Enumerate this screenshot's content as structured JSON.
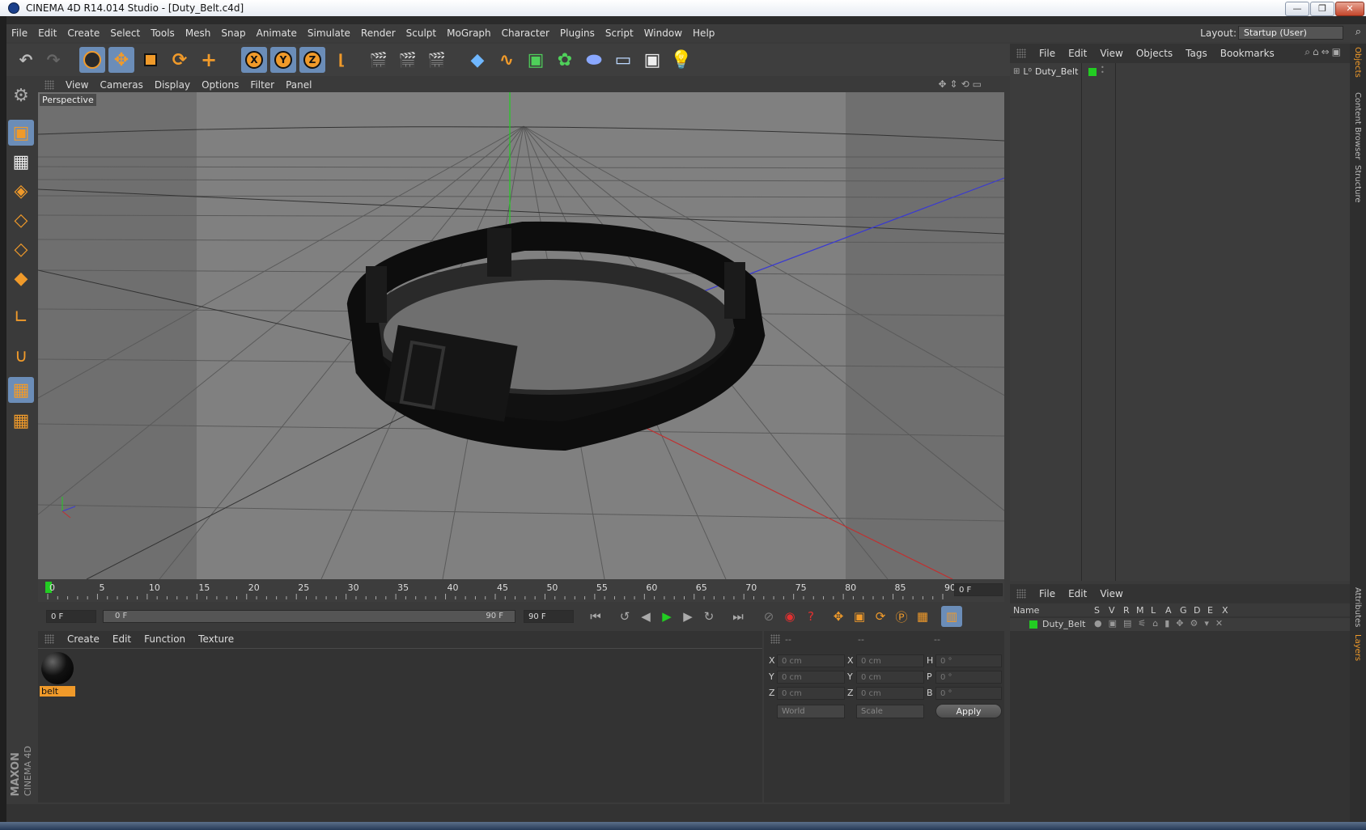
{
  "window": {
    "title": "CINEMA 4D R14.014 Studio - [Duty_Belt.c4d]",
    "min_label": "—",
    "max_label": "❐",
    "close_label": "✕"
  },
  "menubar": {
    "items": [
      "File",
      "Edit",
      "Create",
      "Select",
      "Tools",
      "Mesh",
      "Snap",
      "Animate",
      "Simulate",
      "Render",
      "Sculpt",
      "MoGraph",
      "Character",
      "Plugins",
      "Script",
      "Window",
      "Help"
    ],
    "layout_label": "Layout:",
    "layout_value": "Startup (User)"
  },
  "toolbar": {
    "axis_x": "X",
    "axis_y": "Y",
    "axis_z": "Z"
  },
  "viewport": {
    "menu": [
      "View",
      "Cameras",
      "Display",
      "Options",
      "Filter",
      "Panel"
    ],
    "label": "Perspective"
  },
  "timeline": {
    "ticks": [
      "0",
      "5",
      "10",
      "15",
      "20",
      "25",
      "30",
      "35",
      "40",
      "45",
      "50",
      "55",
      "60",
      "65",
      "70",
      "75",
      "80",
      "85",
      "90"
    ],
    "current_frame": "0 F",
    "start_frame": "0 F",
    "range_start": "0 F",
    "range_end": "90 F",
    "end_frame": "90 F"
  },
  "material_manager": {
    "menu": [
      "Create",
      "Edit",
      "Function",
      "Texture"
    ],
    "materials": [
      {
        "name": "belt"
      }
    ]
  },
  "coordinates": {
    "headers": [
      "--",
      "--",
      "--"
    ],
    "rows": [
      {
        "a": "X",
        "av": "0 cm",
        "b": "X",
        "bv": "0 cm",
        "c": "H",
        "cv": "0 °"
      },
      {
        "a": "Y",
        "av": "0 cm",
        "b": "Y",
        "bv": "0 cm",
        "c": "P",
        "cv": "0 °"
      },
      {
        "a": "Z",
        "av": "0 cm",
        "b": "Z",
        "bv": "0 cm",
        "c": "B",
        "cv": "0 °"
      }
    ],
    "mode": "World",
    "size_mode": "Scale",
    "apply": "Apply"
  },
  "object_manager": {
    "menu": [
      "File",
      "Edit",
      "View",
      "Objects",
      "Tags",
      "Bookmarks"
    ],
    "objects": [
      {
        "name": "Duty_Belt"
      }
    ]
  },
  "layer_manager": {
    "menu": [
      "File",
      "Edit",
      "View"
    ],
    "columns": [
      "Name",
      "S",
      "V",
      "R",
      "M",
      "L",
      "A",
      "G",
      "D",
      "E",
      "X"
    ],
    "rows": [
      {
        "name": "Duty_Belt"
      }
    ]
  },
  "side_tabs": [
    "Objects",
    "Content Browser",
    "Structure"
  ],
  "side_tabs_lower": [
    "Attributes",
    "Layers"
  ],
  "brand": {
    "maxon": "MAXON",
    "product": "CINEMA 4D"
  },
  "colors": {
    "accent": "#f09a2a",
    "selected": "#6b8db8",
    "green": "#22cc22"
  }
}
